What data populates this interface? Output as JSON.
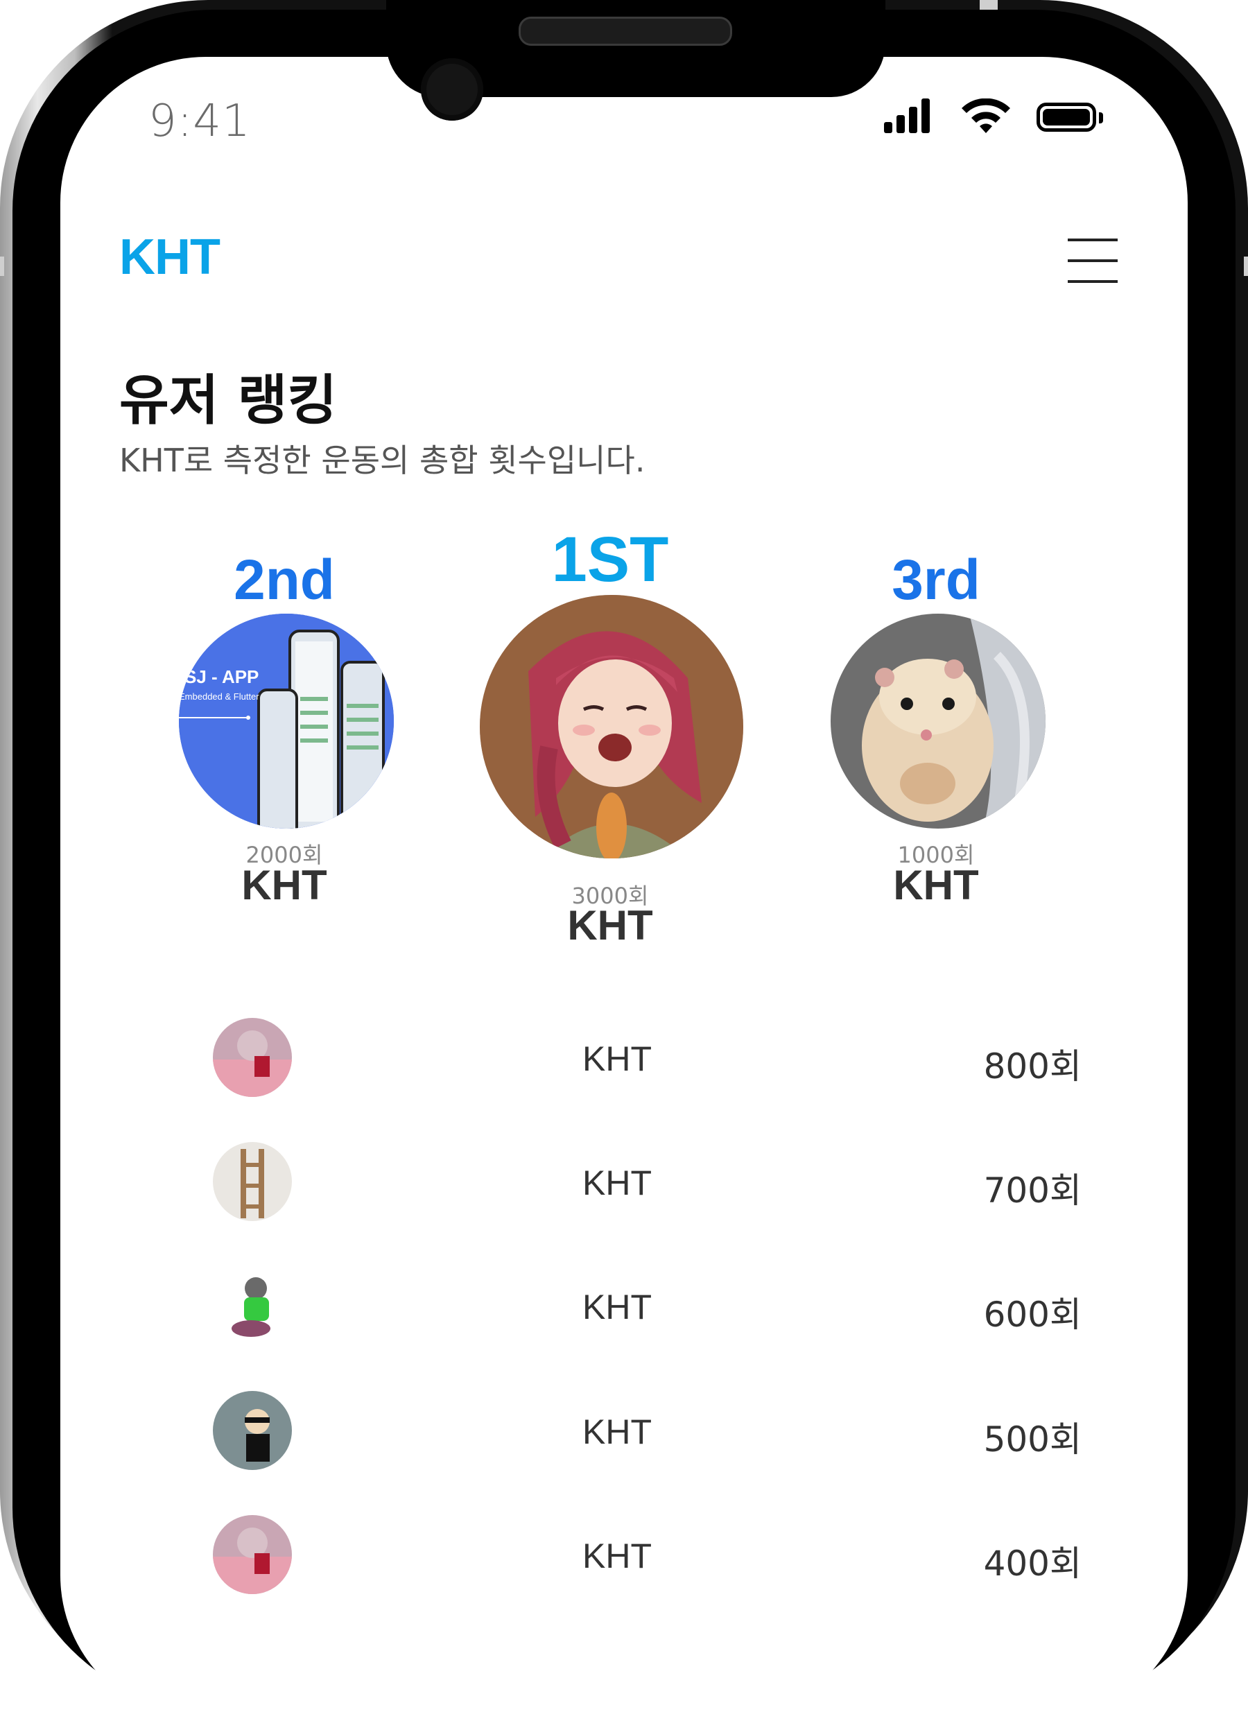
{
  "status_bar": {
    "time": "9:41"
  },
  "header": {
    "brand": "KHT",
    "menu_icon": "hamburger-menu-icon"
  },
  "section": {
    "title": "유저 랭킹",
    "subtitle": "KHT로 측정한 운동의 총합 횟수입니다."
  },
  "podium": [
    {
      "rank_label": "2nd",
      "count": "2000회",
      "name": "KHT",
      "color": "#1a73e8"
    },
    {
      "rank_label": "1ST",
      "count": "3000회",
      "name": "KHT",
      "color": "#0aa3e8"
    },
    {
      "rank_label": "3rd",
      "count": "1000회",
      "name": "KHT",
      "color": "#1a73e8"
    }
  ],
  "podium_avatar_texts": {
    "second_title": "SJ - APP",
    "second_sub": "Embedded & Flutter"
  },
  "ranking_list": [
    {
      "name": "KHT",
      "count": "800회"
    },
    {
      "name": "KHT",
      "count": "700회"
    },
    {
      "name": "KHT",
      "count": "600회"
    },
    {
      "name": "KHT",
      "count": "500회"
    },
    {
      "name": "KHT",
      "count": "400회"
    }
  ]
}
